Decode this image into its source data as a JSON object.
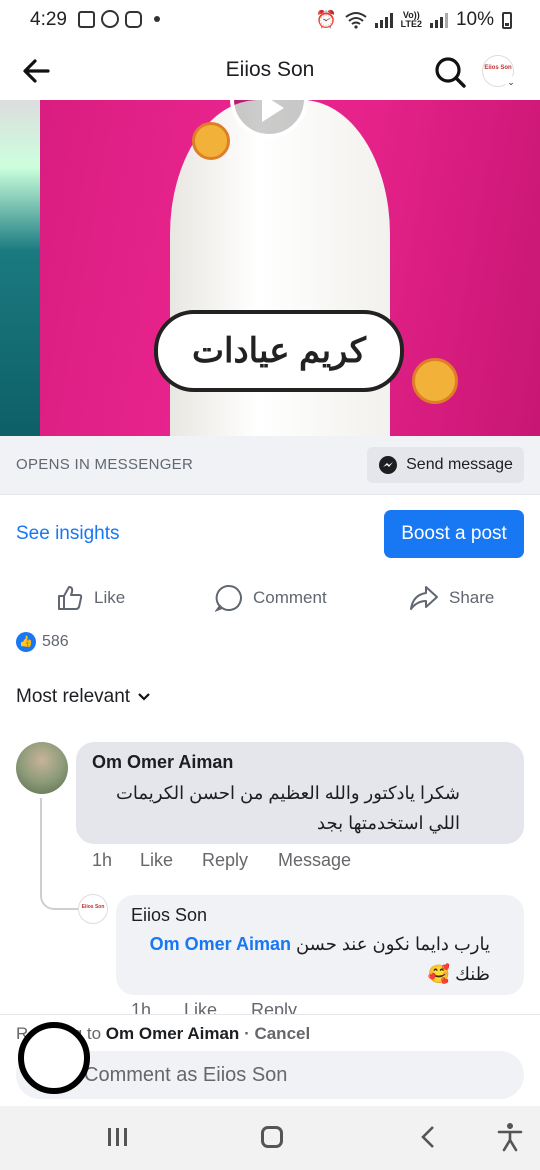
{
  "status_bar": {
    "time": "4:29",
    "battery": "10%",
    "network": "LTE2",
    "network_top": "Vo))"
  },
  "header": {
    "title": "Eiios Son",
    "avatar_text": "Eiios Son"
  },
  "video": {
    "caption": "كريم عيادات"
  },
  "messenger_strip": {
    "label": "OPENS IN MESSENGER",
    "send_button": "Send message"
  },
  "insights": {
    "see_insights": "See insights",
    "boost_button": "Boost a post"
  },
  "actions": {
    "like": "Like",
    "comment": "Comment",
    "share": "Share"
  },
  "reactions": {
    "count": "586"
  },
  "sort": {
    "label": "Most relevant"
  },
  "comments": [
    {
      "author": "Om Omer Aiman",
      "text": "شكرا يادكتور والله العظيم من احسن الكريمات اللي استخدمتها بجد",
      "time": "1h",
      "like": "Like",
      "reply": "Reply",
      "message": "Message"
    },
    {
      "author": "Eiios Son",
      "mention": "Om Omer Aiman",
      "text": "يارب دايما نكون عند حسن",
      "text_end": "ظنك 🥰",
      "time": "1h",
      "like": "Like",
      "reply": "Reply"
    }
  ],
  "composer": {
    "replying_prefix": "Replying to",
    "replying_name": "Om Omer Aiman",
    "cancel": "· Cancel",
    "placeholder": "Comment as Eiios Son"
  },
  "colors": {
    "accent": "#1877f2",
    "bubble": "#e4e6eb"
  }
}
